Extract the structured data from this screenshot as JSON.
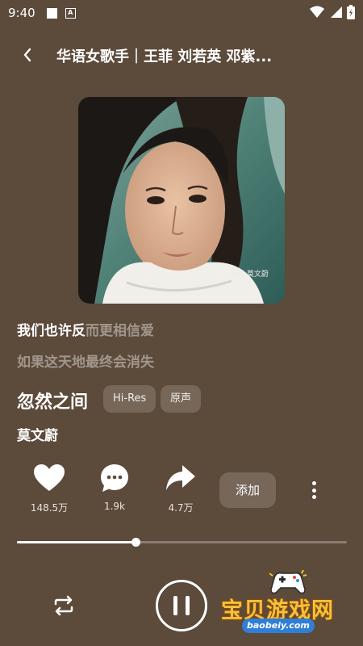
{
  "status_bar": {
    "time": "9:40",
    "notif_badge": "A"
  },
  "header": {
    "title": "华语女歌手｜王菲 刘若英 邓紫..."
  },
  "cover": {
    "text": "就是 莫文蔚"
  },
  "lyrics": {
    "line1_sung": "我们也许反",
    "line1_unsung": "而更相信爱",
    "line2": "如果这天地最终会消失"
  },
  "song": {
    "title": "忽然之间",
    "tags": [
      "Hi-Res",
      "原声"
    ],
    "artist": "莫文蔚"
  },
  "actions": {
    "like_count": "148.5万",
    "comment_count": "1.9k",
    "share_count": "4.7万",
    "add_label": "添加"
  },
  "progress": {
    "fraction": 0.36
  },
  "watermark": {
    "text": "宝贝游戏网",
    "url": "baobeiy.com"
  },
  "colors": {
    "background": "#5c4a3a",
    "accent": "#ffffff",
    "watermark": "#f4c238"
  }
}
